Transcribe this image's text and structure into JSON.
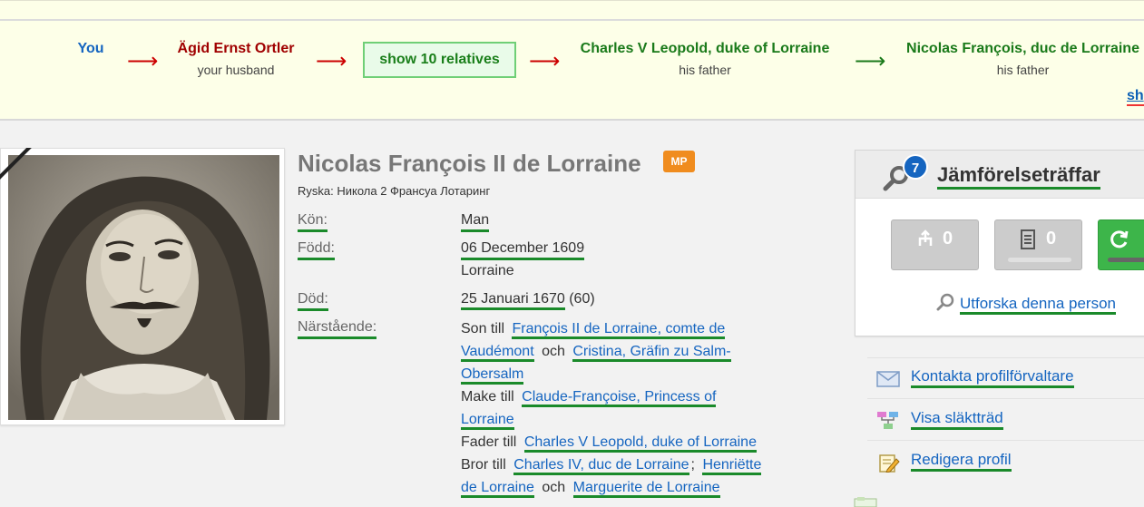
{
  "path": {
    "nodes": [
      {
        "name": "You",
        "sub": "",
        "color": "#1565c0"
      },
      {
        "name": "Ägid Ernst Ortler",
        "sub": "your husband",
        "color": "#a00000"
      },
      {
        "name": "Charles V Leopold, duke of Lorraine",
        "sub": "his father",
        "color": "#1a7a1a"
      },
      {
        "name": "Nicolas François, duc de Lorraine",
        "sub": "his father",
        "color": "#1a7a1a"
      }
    ],
    "arrow": "⟶",
    "show_relatives": "show 10 relatives",
    "show_more": "sh"
  },
  "profile": {
    "name": "Nicolas François II de Lorraine",
    "badge": "MP",
    "alt_name": "Ryska: Никола 2 Франсуа Лотаринг",
    "fields": {
      "gender_label": "Kön:",
      "gender_value": "Man",
      "born_label": "Född:",
      "born_date": "06 December 1609",
      "born_place": "Lorraine",
      "died_label": "Död:",
      "died_date": "25 Januari 1670",
      "died_age": "(60)",
      "relatives_label": "Närstående:"
    },
    "relations": {
      "son_of": "Son till",
      "father_name": "François II de Lorraine, comte de",
      "father_name_2": "Vaudémont",
      "and": "och",
      "mother_name": "Cristina, Gräfin zu Salm-",
      "mother_name_2": "Obersalm",
      "husband_of": "Make till",
      "wife_name": "Claude-Françoise, Princess of",
      "wife_name_2": "Lorraine",
      "father_of": "Fader till",
      "child_name": "Charles V Leopold, duke of Lorraine",
      "brother_of": "Bror till",
      "sibling1": "Charles IV, duc de Lorraine",
      "sep": ";",
      "sibling2": "Henriëtte",
      "sibling2_2": "de Lorraine",
      "sibling3": "Marguerite de Lorraine"
    }
  },
  "matches": {
    "count": "7",
    "title": "Jämförelseträffar",
    "tree_count": "0",
    "record_count": "0",
    "explore": "Utforska denna person"
  },
  "actions": {
    "contact": "Kontakta profilförvaltare",
    "tree": "Visa släktträd",
    "edit": "Redigera profil"
  },
  "colors": {
    "link": "#1565c0",
    "underline": "#1a8a2a",
    "badge": "#f08c1e",
    "path_bg": "#fdffe8"
  }
}
